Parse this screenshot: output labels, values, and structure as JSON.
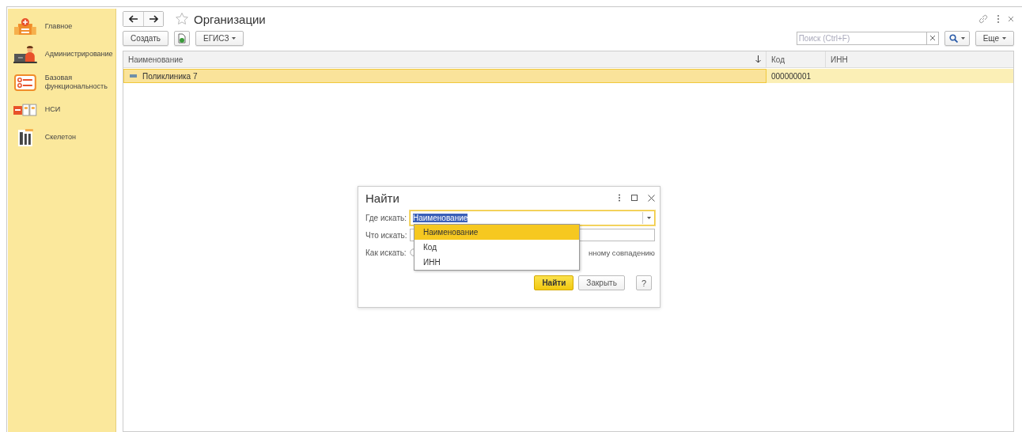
{
  "sidebar": {
    "items": [
      {
        "label": "Главное"
      },
      {
        "label": "Администрирование"
      },
      {
        "label": "Базовая функциональность"
      },
      {
        "label": "НСИ"
      },
      {
        "label": "Скелетон"
      }
    ]
  },
  "header": {
    "title": "Организации",
    "favorite": false
  },
  "toolbar": {
    "buttons": [
      {
        "kind": "text",
        "label": "Создать"
      },
      {
        "kind": "icon"
      },
      {
        "kind": "menu",
        "label": "ЕГИСЗ"
      }
    ],
    "search": {
      "placeholder": "Поиск (Ctrl+F)"
    },
    "more": {
      "label": "Еще"
    }
  },
  "table": {
    "columns": [
      {
        "label": "Наименование",
        "sorted": true
      },
      {
        "label": "Код",
        "sorted": false
      },
      {
        "label": "ИНН",
        "sorted": false
      }
    ],
    "rows": [
      {
        "name": "Поликлиника 7",
        "code": "000000001",
        "selected": true
      }
    ]
  },
  "dialog": {
    "title": "Найти",
    "fields": [
      {
        "kind": "combo",
        "label": "Где искать:",
        "value": "Наименование"
      },
      {
        "kind": "text",
        "label": "Что искать:"
      },
      {
        "kind": "radio",
        "label": "Как искать:",
        "text": "нному совпадению"
      }
    ],
    "dropdown": [
      {
        "label": "Наименование",
        "selected": true
      },
      {
        "label": "Код",
        "selected": false
      },
      {
        "label": "ИНН",
        "selected": false
      }
    ],
    "buttons": [
      {
        "kind": "primary",
        "label": "Найти"
      },
      {
        "kind": "default",
        "label": "Закрыть"
      },
      {
        "kind": "help",
        "label": "?"
      }
    ]
  }
}
